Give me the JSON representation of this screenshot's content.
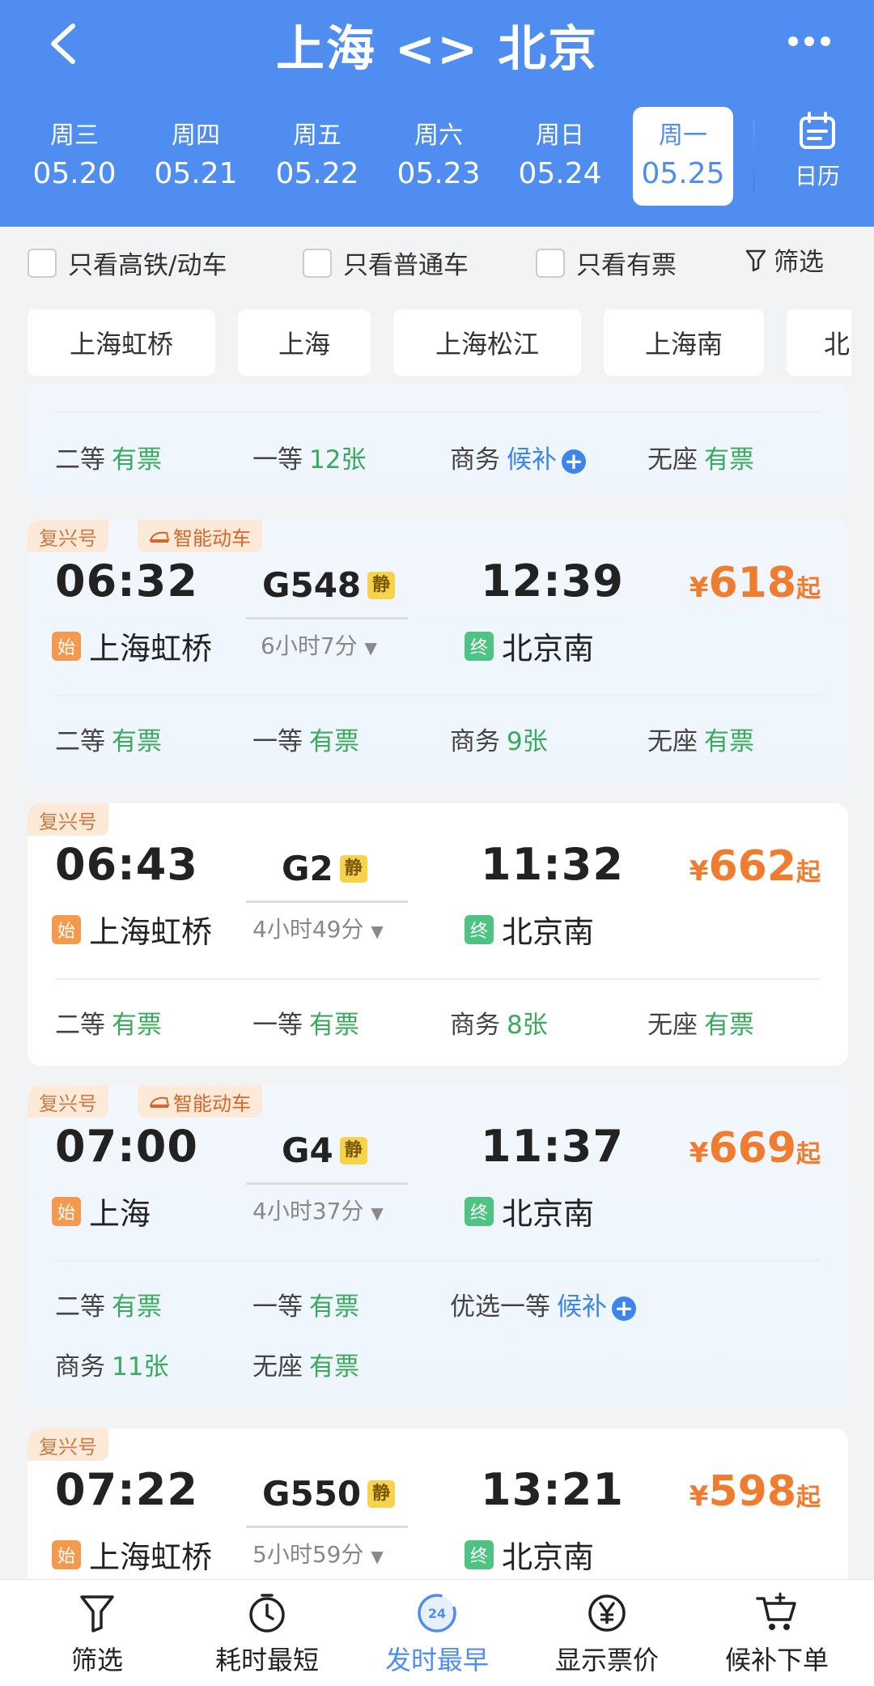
{
  "header": {
    "title": "上海 <> 北京",
    "dates": [
      {
        "weekday": "周三",
        "date": "05.20"
      },
      {
        "weekday": "周四",
        "date": "05.21"
      },
      {
        "weekday": "周五",
        "date": "05.22"
      },
      {
        "weekday": "周六",
        "date": "05.23"
      },
      {
        "weekday": "周日",
        "date": "05.24"
      },
      {
        "weekday": "周一",
        "date": "05.25"
      }
    ],
    "calendar_label": "日历"
  },
  "filters": {
    "high_speed": "只看高铁/动车",
    "normal": "只看普通车",
    "available": "只看有票",
    "filter": "筛选"
  },
  "stations": [
    "上海虹桥",
    "上海",
    "上海松江",
    "上海南",
    "北"
  ],
  "partial_card": {
    "seats": [
      {
        "type": "二等",
        "value": "有票"
      },
      {
        "type": "一等",
        "value": "12张"
      },
      {
        "type": "商务",
        "value": "候补"
      },
      {
        "type": "无座",
        "value": "有票"
      }
    ]
  },
  "trains": [
    {
      "badge": "复兴号",
      "badge2": "智能动车",
      "dep": "06:32",
      "no": "G548",
      "quiet": "静",
      "arr": "12:39",
      "price_sym": "¥",
      "price": "618",
      "price_suffix": "起",
      "start_tag": "始",
      "from": "上海虹桥",
      "duration": "6小时7分",
      "end_tag": "终",
      "to": "北京南",
      "seats": [
        {
          "type": "二等",
          "value": "有票"
        },
        {
          "type": "一等",
          "value": "有票"
        },
        {
          "type": "商务",
          "value": "9张"
        },
        {
          "type": "无座",
          "value": "有票"
        }
      ]
    },
    {
      "badge": "复兴号",
      "dep": "06:43",
      "no": "G2",
      "quiet": "静",
      "arr": "11:32",
      "price_sym": "¥",
      "price": "662",
      "price_suffix": "起",
      "start_tag": "始",
      "from": "上海虹桥",
      "duration": "4小时49分",
      "end_tag": "终",
      "to": "北京南",
      "seats": [
        {
          "type": "二等",
          "value": "有票"
        },
        {
          "type": "一等",
          "value": "有票"
        },
        {
          "type": "商务",
          "value": "8张"
        },
        {
          "type": "无座",
          "value": "有票"
        }
      ]
    },
    {
      "badge": "复兴号",
      "badge2": "智能动车",
      "dep": "07:00",
      "no": "G4",
      "quiet": "静",
      "arr": "11:37",
      "price_sym": "¥",
      "price": "669",
      "price_suffix": "起",
      "start_tag": "始",
      "from": "上海",
      "duration": "4小时37分",
      "end_tag": "终",
      "to": "北京南",
      "seats": [
        {
          "type": "二等",
          "value": "有票"
        },
        {
          "type": "一等",
          "value": "有票"
        },
        {
          "type": "优选一等",
          "value": "候补"
        },
        {
          "type": "商务",
          "value": "11张"
        },
        {
          "type": "无座",
          "value": "有票"
        }
      ]
    },
    {
      "badge": "复兴号",
      "dep": "07:22",
      "no": "G550",
      "quiet": "静",
      "arr": "13:21",
      "price_sym": "¥",
      "price": "598",
      "price_suffix": "起",
      "start_tag": "始",
      "from": "上海虹桥",
      "duration": "5小时59分",
      "end_tag": "终",
      "to": "北京南"
    }
  ],
  "bottom_nav": [
    {
      "label": "筛选",
      "icon": "filter-icon"
    },
    {
      "label": "耗时最短",
      "icon": "stopwatch-icon"
    },
    {
      "label": "发时最早",
      "icon": "clock-24-icon",
      "badge": "24"
    },
    {
      "label": "显示票价",
      "icon": "yen-icon"
    },
    {
      "label": "候补下单",
      "icon": "cart-plus-icon"
    }
  ],
  "colors": {
    "header": "#4f8ef0",
    "available": "#3aaa5c",
    "waitlist": "#3d84ee",
    "price": "#f07c2f"
  }
}
